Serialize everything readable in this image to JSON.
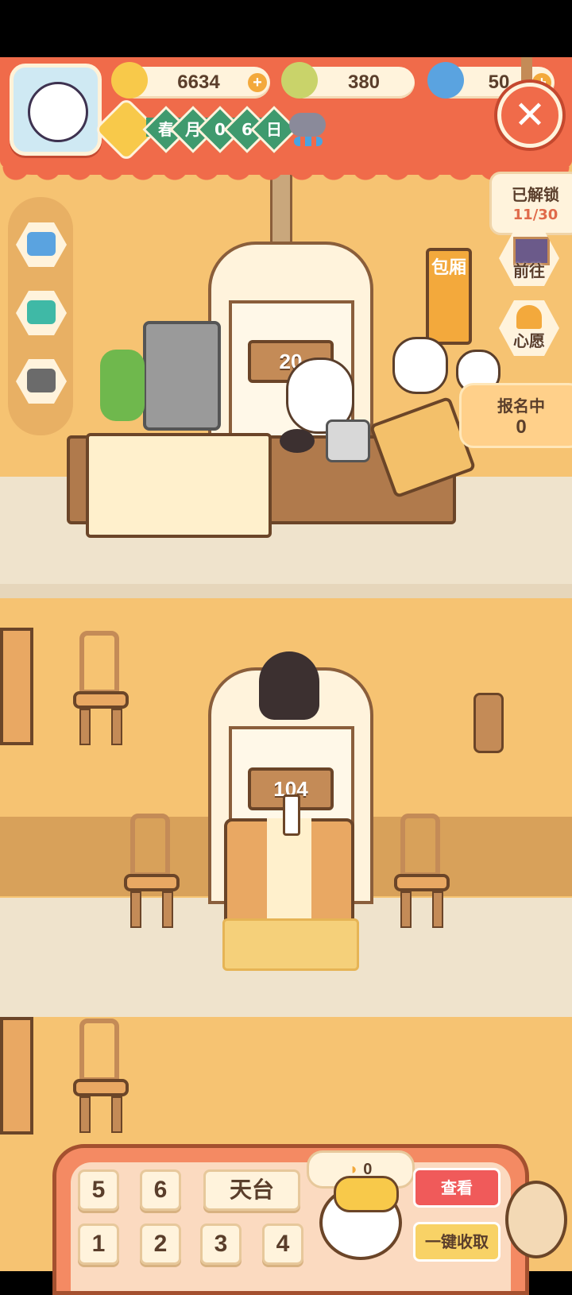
{
  "header": {
    "bananas": "6634",
    "clovers": "380",
    "blue_bananas": "50",
    "date": [
      "春",
      "月",
      "0",
      "6",
      "日"
    ],
    "weather_icon": "rain-cloud-icon"
  },
  "right_panel": {
    "unlocked_label": "已解锁",
    "unlocked_count": "11/30",
    "goto_label": "前往",
    "wish_label": "心愿",
    "signup_label": "报名中",
    "signup_count": "0"
  },
  "rooms": {
    "private_room_sign": "包厢",
    "room_upper_number": "20",
    "room_lower_number": "104"
  },
  "bottom": {
    "floors_top": [
      "5",
      "6",
      "天台"
    ],
    "floors_bottom": [
      "1",
      "2",
      "3",
      "4"
    ],
    "coin_count": "0",
    "view_label": "查看",
    "collect_label": "一键收取"
  },
  "colors": {
    "header_red": "#f06b4a",
    "wall": "#f6c372",
    "cream": "#fff3dc",
    "wood": "#c48b57",
    "green_chip": "#3f9a6e"
  }
}
